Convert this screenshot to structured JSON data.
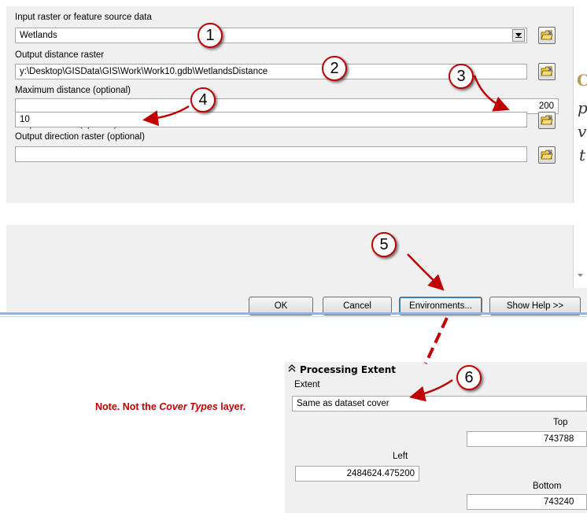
{
  "tool_dialog": {
    "input_label": "Input raster or feature source data",
    "input_value": "Wetlands",
    "output_label": "Output distance raster",
    "output_value": "y:\\Desktop\\GISData\\GIS\\Work\\Work10.gdb\\WetlandsDistance",
    "maxdist_label": "Maximum distance (optional)",
    "maxdist_value": "200",
    "cellsize_label": "Output cell size (optional)",
    "cellsize_value": "10",
    "direction_label": "Output direction raster (optional)",
    "direction_value": ""
  },
  "side_text": [
    "C",
    "p",
    "v",
    "t"
  ],
  "buttons": {
    "ok": "OK",
    "cancel": "Cancel",
    "environments": "Environments...",
    "show_help": "Show Help >>"
  },
  "callouts": [
    "1",
    "2",
    "3",
    "4",
    "5",
    "6"
  ],
  "note": {
    "prefix": "Note. Not the ",
    "emphasis": "Cover Types",
    "suffix": " layer."
  },
  "processing_extent": {
    "title": "Processing Extent",
    "extent_label": "Extent",
    "extent_value": "Same as dataset cover",
    "top_label": "Top",
    "top_value": "743788",
    "left_label": "Left",
    "left_value": "2484624.475200",
    "bottom_label": "Bottom",
    "bottom_value": "743240"
  },
  "colors": {
    "annotation_red": "#c00000",
    "dialog_bg": "#f0f0f0",
    "separator_blue": "#8fb4e4"
  },
  "icons": [
    "dropdown-arrow-icon",
    "folder-open-icon",
    "collapse-chevrons-icon",
    "scroll-down-arrow-icon"
  ]
}
